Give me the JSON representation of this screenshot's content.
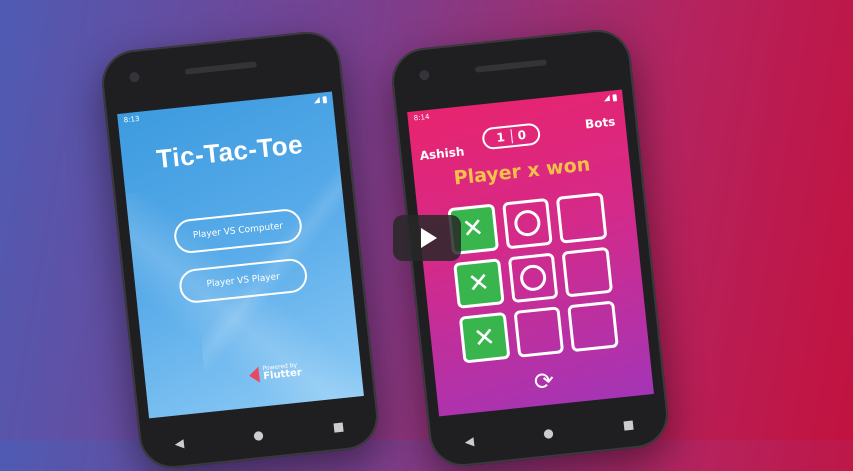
{
  "phone1": {
    "status_time": "8:13",
    "title": "Tic-Tac-Toe",
    "buttons": [
      "Player VS Computer",
      "Player VS Player"
    ],
    "footer_small": "Powered by",
    "footer_big": "Flutter"
  },
  "phone2": {
    "status_time": "8:14",
    "left_player": "Ashish",
    "right_player": "Bots",
    "score_left": "1",
    "score_right": "0",
    "winner_text": "Player x won",
    "board": [
      "X",
      "O",
      "",
      "X",
      "O",
      "",
      "X",
      "",
      ""
    ],
    "win_cells": [
      0,
      3,
      6
    ]
  },
  "nav_icons": [
    "back-icon",
    "home-icon",
    "recents-icon"
  ],
  "colors": {
    "screen1_blue": "#5aacea",
    "screen2_pink": "#e8246e",
    "screen2_purple": "#a435b6",
    "win_green": "#38b54d",
    "winner_text": "#f7c04a"
  }
}
